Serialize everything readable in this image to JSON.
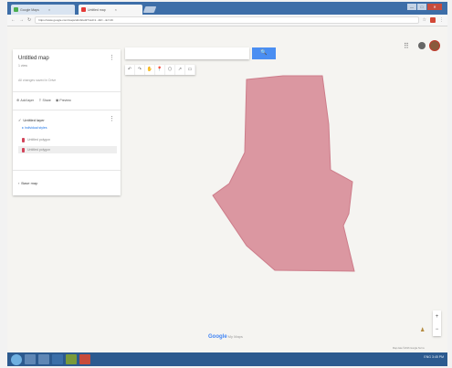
{
  "browser": {
    "tabs": [
      {
        "label": "Google Maps",
        "favicon_color": "#4caf50"
      },
      {
        "label": "Untitled map",
        "favicon_color": "#e53935"
      }
    ],
    "url": "https://www.google.com/maps/d/u/0/edit?mid=1...&ll=...&z=16",
    "win_buttons": {
      "min": "—",
      "max": "□",
      "close": "✕"
    }
  },
  "panel": {
    "title": "Untitled map",
    "subtitle": "1 view",
    "saved_status": "All changes saved in Drive",
    "actions": [
      {
        "label": "Add layer",
        "icon": "layer-icon"
      },
      {
        "label": "Share",
        "icon": "share-icon"
      },
      {
        "label": "Preview",
        "icon": "eye-icon"
      }
    ],
    "layer": {
      "title": "Untitled layer",
      "style_label": "Individual styles",
      "features": [
        {
          "label": "Untitled polygon"
        },
        {
          "label": "Untitled polygon"
        }
      ]
    },
    "basemap_label": "Base map"
  },
  "search": {
    "placeholder": "",
    "button_icon": "🔍"
  },
  "toolbar": {
    "tools": [
      "↶",
      "↷",
      "✋",
      "📍",
      "⬡",
      "↗",
      "▭"
    ]
  },
  "map": {
    "polygon_color": "#d98d99",
    "polygon_stroke": "#c9707f"
  },
  "zoom": {
    "plus": "+",
    "minus": "−"
  },
  "logo": {
    "google": "Google",
    "product": "My Maps"
  },
  "attribution": "Map data ©2016 Google  Terms",
  "taskbar": {
    "tray_text": "ENG  3:45 PM"
  }
}
